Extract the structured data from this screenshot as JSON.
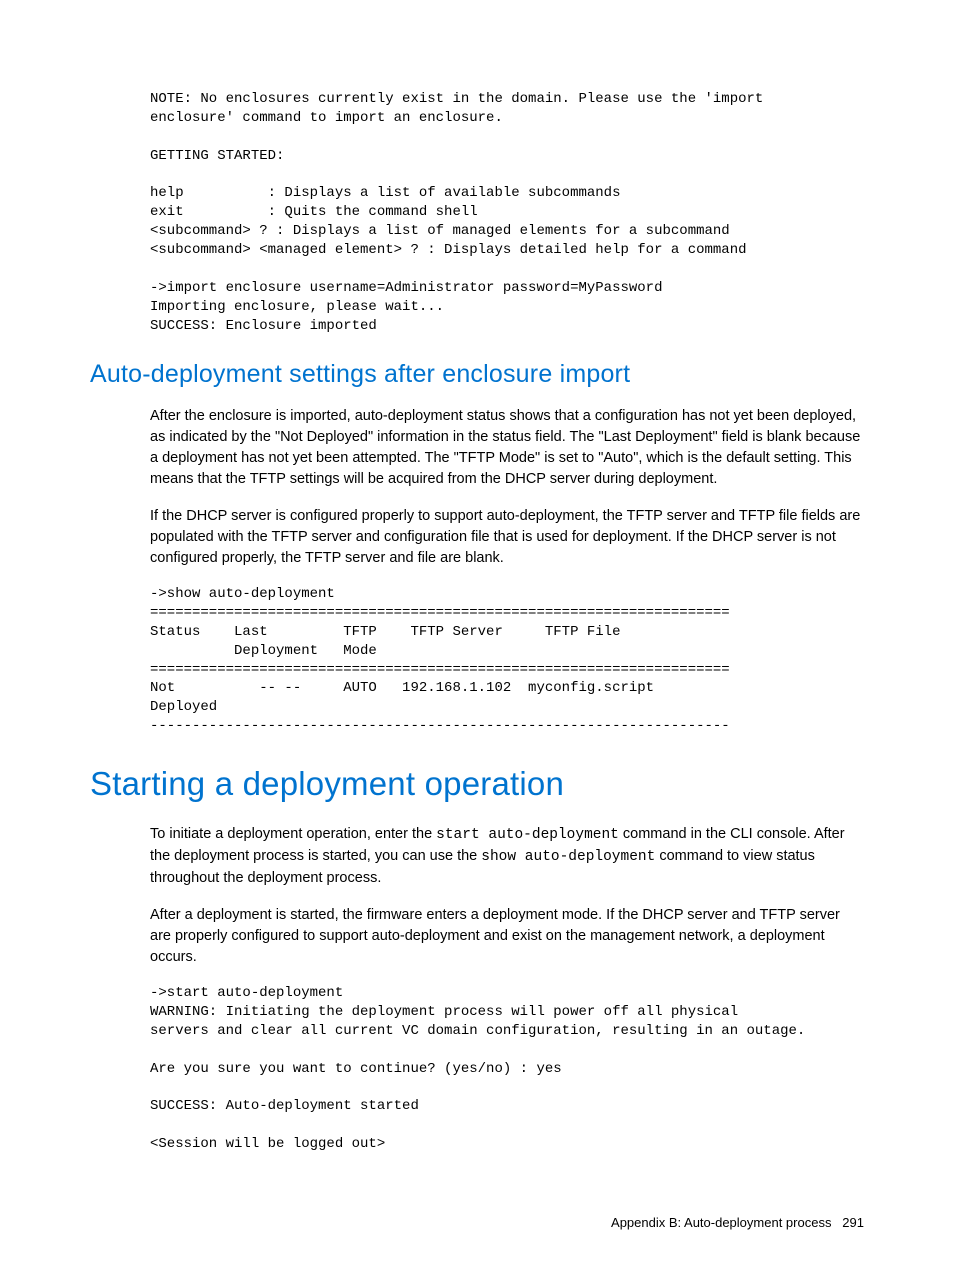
{
  "code1": "NOTE: No enclosures currently exist in the domain. Please use the 'import\nenclosure' command to import an enclosure.\n\nGETTING STARTED:\n\nhelp          : Displays a list of available subcommands\nexit          : Quits the command shell\n<subcommand> ? : Displays a list of managed elements for a subcommand\n<subcommand> <managed element> ? : Displays detailed help for a command\n\n->import enclosure username=Administrator password=MyPassword\nImporting enclosure, please wait...\nSUCCESS: Enclosure imported",
  "h2_1": "Auto-deployment settings after enclosure import",
  "p1": "After the enclosure is imported, auto-deployment status shows that a configuration has not yet been deployed, as indicated by the \"Not Deployed\" information in the status field. The \"Last Deployment\" field is blank because a deployment has not yet been attempted. The \"TFTP Mode\" is set to \"Auto\", which is the default setting. This means that the TFTP settings will be acquired from the DHCP server during deployment.",
  "p2": "If the DHCP server is configured properly to support auto-deployment, the TFTP server and TFTP file fields are populated with the TFTP server and configuration file that is used for deployment. If the DHCP server is not configured properly, the TFTP server and file are blank.",
  "code2": "->show auto-deployment\n=====================================================================\nStatus    Last         TFTP    TFTP Server     TFTP File\n          Deployment   Mode\n=====================================================================\nNot          -- --     AUTO   192.168.1.102  myconfig.script\nDeployed\n---------------------------------------------------------------------",
  "h1_1": "Starting a deployment operation",
  "p3a": "To initiate a deployment operation, enter the ",
  "p3cmd1": "start auto-deployment",
  "p3b": " command in the CLI console. After the deployment process is started, you can use the ",
  "p3cmd2": "show auto-deployment",
  "p3c": " command to view status throughout the deployment process.",
  "p4": "After a deployment is started, the firmware enters a deployment mode. If the DHCP server and TFTP server are properly configured to support auto-deployment and exist on the management network, a deployment occurs.",
  "code3": "->start auto-deployment\nWARNING: Initiating the deployment process will power off all physical\nservers and clear all current VC domain configuration, resulting in an outage.\n\nAre you sure you want to continue? (yes/no) : yes\n\nSUCCESS: Auto-deployment started\n\n<Session will be logged out>",
  "footer_label": "Appendix B: Auto-deployment process",
  "footer_page": "291"
}
